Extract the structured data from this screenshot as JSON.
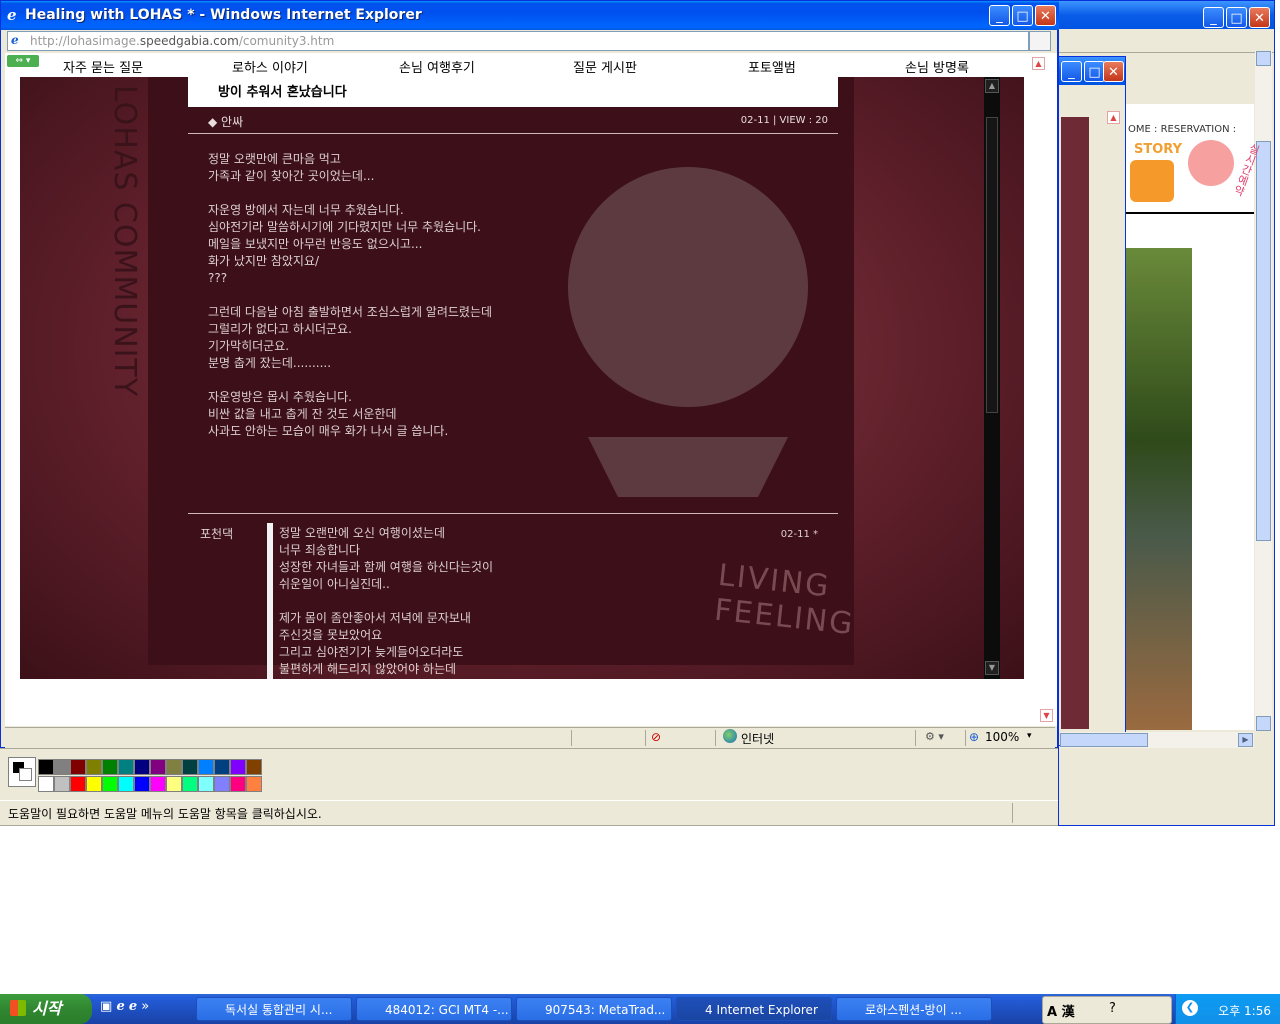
{
  "ie": {
    "title": "Healing with LOHAS * - Windows Internet Explorer",
    "url_prefix": "http://lohasimage.",
    "url_domain": "speedgabia.com",
    "url_path": "/comunity3.htm",
    "status_zone": "인터넷",
    "zoom": "100%"
  },
  "nav": {
    "items": [
      "자주 묻는 질문",
      "로하스 이야기",
      "손님 여행후기",
      "질문 게시판",
      "포토앨범",
      "손님 방명록"
    ]
  },
  "site": {
    "vertical_text": "LOHAS COMMUNITY",
    "living_text": "LIVING FEELING"
  },
  "post": {
    "title": "방이 추워서 혼났습니다",
    "author": "◆ 안싸",
    "date_views": "02-11 | VIEW : 20",
    "body": "정말 오랫만에 큰마음 먹고\n가족과 같이 찾아간 곳이었는데...\n\n자운영 방에서 자는데 너무 추웠습니다.\n심야전기라 말씀하시기에 기다렸지만 너무 추웠습니다.\n메일을 보냈지만 아무런 반응도 없으시고...\n화가 났지만 참았지요/\n???\n\n그런데 다음날 아침 출발하면서 조심스럽게 알려드렸는데\n그럴리가 없다고 하시더군요.\n기가막히더군요.\n분명 춥게 잤는데..........\n\n자운영방은 몹시 추웠습니다.\n비싼 값을 내고 춥게 잔 것도 서운한데\n사과도 안하는 모습이 매우 화가 나서 글 씁니다."
  },
  "comment": {
    "name": "포천댁",
    "date": "02-11 *",
    "text": "정말 오랜만에 오신 여행이셨는데\n너무 죄송합니다\n성장한 자녀들과 함께 여행을 하신다는것이\n쉬운일이 아니실진데..\n\n제가 몸이 좀안좋아서 저녁에 문자보내\n주신것을 못보았어요\n그리고 심야전기가 늦게들어오더라도\n불편하게 해드리지 않았어야 하는데"
  },
  "back_ie": {
    "nav_home": "OME",
    "nav_sep": ":",
    "nav_reservation": "RESERVATION",
    "nav_sep2": ":",
    "story": "STORY",
    "realtime": "실시간예약"
  },
  "paint": {
    "status": "도움말이 필요하면 도움말 메뉴의 도움말 항목을 클릭하십시오.",
    "palette_top": [
      "#000000",
      "#808080",
      "#800000",
      "#808000",
      "#008000",
      "#008080",
      "#000080",
      "#800080",
      "#808040",
      "#004040",
      "#0080ff",
      "#004080",
      "#8000ff",
      "#804000"
    ],
    "palette_bottom": [
      "#ffffff",
      "#c0c0c0",
      "#ff0000",
      "#ffff00",
      "#00ff00",
      "#00ffff",
      "#0000ff",
      "#ff00ff",
      "#ffff80",
      "#00ff80",
      "#80ffff",
      "#8080ff",
      "#ff0080",
      "#ff8040"
    ]
  },
  "taskbar": {
    "start": "시작",
    "tasks": [
      "독서실 통합관리 시...",
      "484012: GCI MT4 -...",
      "907543: MetaTrad...",
      "4 Internet Explorer",
      "로하스펜션-방이 ..."
    ],
    "ime": "A 漢",
    "clock": "오후 1:56"
  },
  "icons": [
    "ie-icon",
    "minimize-icon",
    "maximize-icon",
    "close-icon",
    "go-icon",
    "globe-icon",
    "zoom-icon",
    "windows-flag-icon"
  ],
  "colors": {
    "title_blue": "#0053ee",
    "close_red": "#c3361a",
    "stage_bg": "#6e2a35",
    "taskbar_blue": "#245edb",
    "start_green": "#318731"
  }
}
